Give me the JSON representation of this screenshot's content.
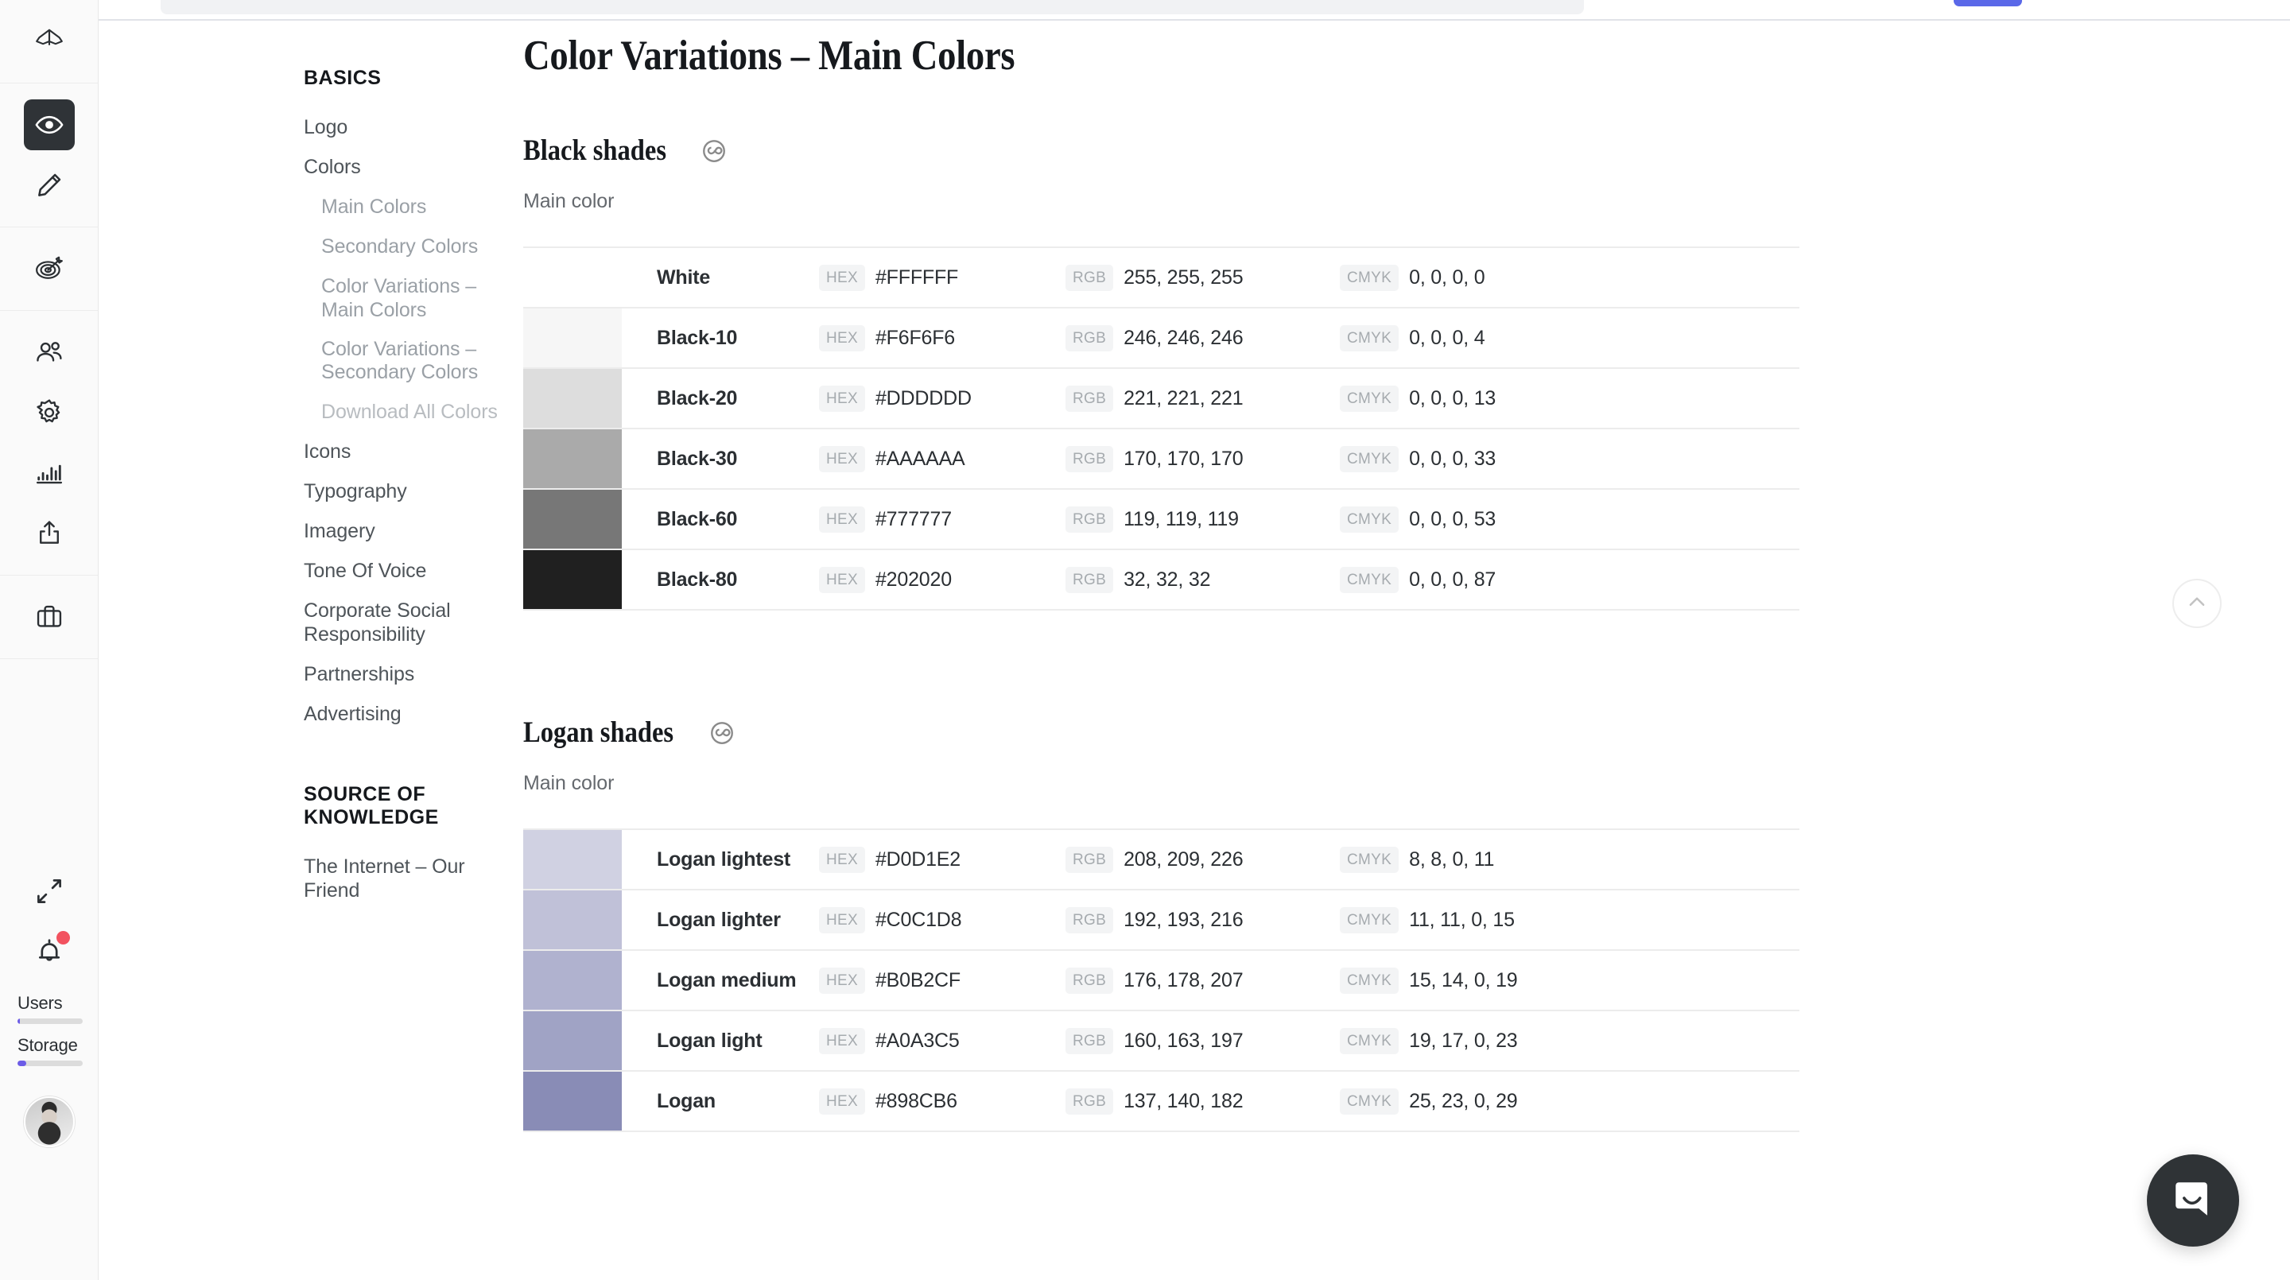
{
  "rail": {
    "items": [
      {
        "name": "brand-logo",
        "icon": "logo-icon"
      },
      {
        "name": "preview",
        "icon": "eye-icon",
        "active": true
      },
      {
        "name": "edit",
        "icon": "pencil-icon",
        "active": false
      },
      {
        "name": "goals",
        "icon": "target-icon",
        "active": false
      },
      {
        "name": "users",
        "icon": "users-icon",
        "active": false
      },
      {
        "name": "settings",
        "icon": "gear-icon",
        "active": false
      },
      {
        "name": "analytics",
        "icon": "bar-chart-icon",
        "active": false
      },
      {
        "name": "share",
        "icon": "share-icon",
        "active": false
      },
      {
        "name": "briefcase",
        "icon": "briefcase-icon",
        "active": false
      },
      {
        "name": "expand",
        "icon": "expand-arrows-icon",
        "active": false
      },
      {
        "name": "notifications",
        "icon": "bell-icon",
        "active": false,
        "badge": true
      }
    ],
    "meters": [
      {
        "label": "Users",
        "percent": 4,
        "color": "#6C5CE7"
      },
      {
        "label": "Storage",
        "percent": 14,
        "color": "#6C5CE7"
      }
    ],
    "badge_color": "#F2525F"
  },
  "sidenav": {
    "sections": [
      {
        "title": "BASICS",
        "items": [
          {
            "label": "Logo",
            "level": 0,
            "muted": false
          },
          {
            "label": "Colors",
            "level": 0,
            "muted": false
          },
          {
            "label": "Main Colors",
            "level": 1,
            "muted": false
          },
          {
            "label": "Secondary Colors",
            "level": 1,
            "muted": false
          },
          {
            "label": "Color Variations – Main Colors",
            "level": 1,
            "muted": false
          },
          {
            "label": "Color Variations – Secondary Colors",
            "level": 1,
            "muted": false
          },
          {
            "label": "Download All Colors",
            "level": 1,
            "muted": true
          },
          {
            "label": "Icons",
            "level": 0,
            "muted": false
          },
          {
            "label": "Typography",
            "level": 0,
            "muted": false
          },
          {
            "label": "Imagery",
            "level": 0,
            "muted": false
          },
          {
            "label": "Tone Of Voice",
            "level": 0,
            "muted": false
          },
          {
            "label": "Corporate Social Responsibility",
            "level": 0,
            "muted": false
          },
          {
            "label": "Partnerships",
            "level": 0,
            "muted": false
          },
          {
            "label": "Advertising",
            "level": 0,
            "muted": false
          }
        ]
      },
      {
        "title": "SOURCE OF KNOWLEDGE",
        "items": [
          {
            "label": "The Internet – Our Friend",
            "level": 0,
            "muted": false
          }
        ]
      }
    ]
  },
  "page": {
    "title": "Color Variations – Main Colors"
  },
  "sections": [
    {
      "heading": "Black shades",
      "badge_icon": "adobe-creative-cloud-icon",
      "subtitle": "Main color",
      "columns": {
        "hex": "HEX",
        "rgb": "RGB",
        "cmyk": "CMYK"
      },
      "rows": [
        {
          "name": "White",
          "swatch": "#FFFFFF",
          "hex": "#FFFFFF",
          "rgb": "255, 255, 255",
          "cmyk": "0, 0, 0, 0",
          "show_swatch": false
        },
        {
          "name": "Black-10",
          "swatch": "#F6F6F6",
          "hex": "#F6F6F6",
          "rgb": "246, 246, 246",
          "cmyk": "0, 0, 0, 4",
          "show_swatch": true
        },
        {
          "name": "Black-20",
          "swatch": "#DDDDDD",
          "hex": "#DDDDDD",
          "rgb": "221, 221, 221",
          "cmyk": "0, 0, 0, 13",
          "show_swatch": true
        },
        {
          "name": "Black-30",
          "swatch": "#AAAAAA",
          "hex": "#AAAAAA",
          "rgb": "170, 170, 170",
          "cmyk": "0, 0, 0, 33",
          "show_swatch": true
        },
        {
          "name": "Black-60",
          "swatch": "#777777",
          "hex": "#777777",
          "rgb": "119, 119, 119",
          "cmyk": "0, 0, 0, 53",
          "show_swatch": true
        },
        {
          "name": "Black-80",
          "swatch": "#202020",
          "hex": "#202020",
          "rgb": "32, 32, 32",
          "cmyk": "0, 0, 0, 87",
          "show_swatch": true
        }
      ]
    },
    {
      "heading": "Logan shades",
      "badge_icon": "adobe-creative-cloud-icon",
      "subtitle": "Main color",
      "columns": {
        "hex": "HEX",
        "rgb": "RGB",
        "cmyk": "CMYK"
      },
      "rows": [
        {
          "name": "Logan lightest",
          "swatch": "#D0D1E2",
          "hex": "#D0D1E2",
          "rgb": "208, 209, 226",
          "cmyk": "8, 8, 0, 11",
          "show_swatch": true
        },
        {
          "name": "Logan lighter",
          "swatch": "#C0C1D8",
          "hex": "#C0C1D8",
          "rgb": "192, 193, 216",
          "cmyk": "11, 11, 0, 15",
          "show_swatch": true
        },
        {
          "name": "Logan medium",
          "swatch": "#B0B2CF",
          "hex": "#B0B2CF",
          "rgb": "176, 178, 207",
          "cmyk": "15, 14, 0, 19",
          "show_swatch": true
        },
        {
          "name": "Logan light",
          "swatch": "#A0A3C5",
          "hex": "#A0A3C5",
          "rgb": "160, 163, 197",
          "cmyk": "19, 17, 0, 23",
          "show_swatch": true
        },
        {
          "name": "Logan",
          "swatch": "#898CB6",
          "hex": "#898CB6",
          "rgb": "137, 140, 182",
          "cmyk": "25, 23, 0, 29",
          "show_swatch": true
        }
      ]
    }
  ],
  "floating": {
    "scroll_top_icon": "chevron-up-icon",
    "chat_icon": "intercom-chat-icon",
    "chat_bg": "#2F3336"
  },
  "topbar": {
    "primary_button_color": "#5A68E8",
    "search_bg": "#F1F2F4"
  }
}
